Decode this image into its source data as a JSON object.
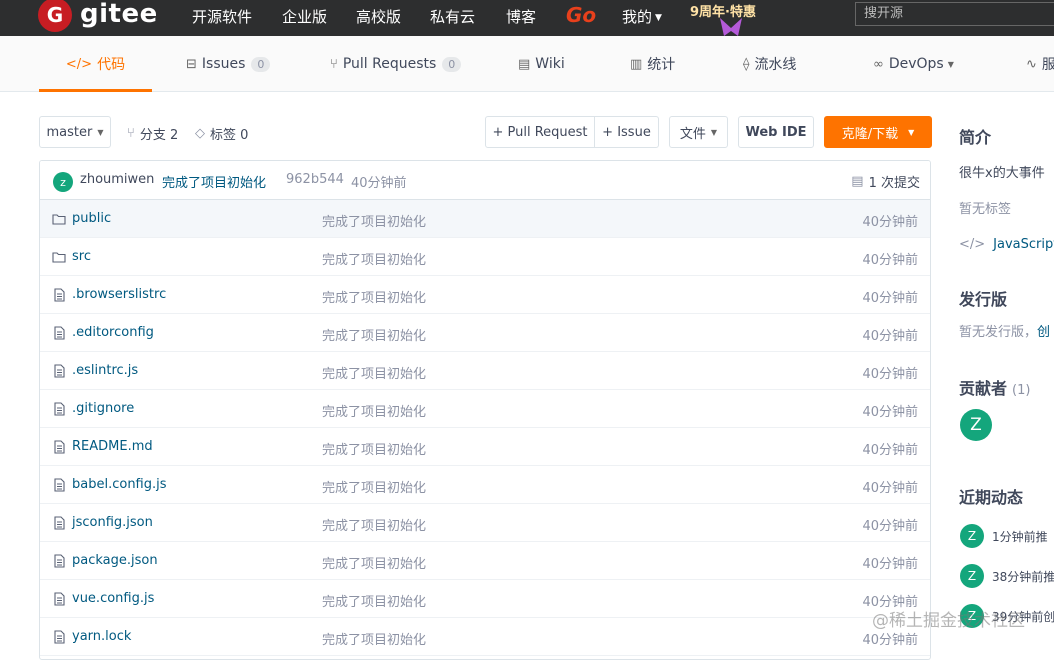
{
  "topnav": {
    "logo_letter": "G",
    "logo_text": "gitee",
    "items": [
      "开源软件",
      "企业版",
      "高校版",
      "私有云",
      "博客"
    ],
    "go_label": "Go",
    "mine_label": "我的",
    "promo": "9周年·特惠",
    "search_placeholder": "搜开源"
  },
  "tabs": [
    {
      "label": "代码",
      "icon": "code-icon",
      "glyph": "</>"
    },
    {
      "label": "Issues",
      "icon": "issue-icon",
      "glyph": "⊟",
      "count": "0"
    },
    {
      "label": "Pull Requests",
      "icon": "pull-request-icon",
      "glyph": "⑂",
      "count": "0"
    },
    {
      "label": "Wiki",
      "icon": "book-icon",
      "glyph": "▤"
    },
    {
      "label": "统计",
      "icon": "bar-chart-icon",
      "glyph": "▥"
    },
    {
      "label": "流水线",
      "icon": "pipeline-icon",
      "glyph": "⟠"
    },
    {
      "label": "DevOps",
      "icon": "infinity-icon",
      "glyph": "∞"
    },
    {
      "label": "服",
      "icon": "pulse-icon",
      "glyph": "∿"
    }
  ],
  "toolbar": {
    "branch": "master",
    "branches_label": "分支 2",
    "tags_label": "标签 0",
    "new_pr": "+ Pull Request",
    "new_issue": "+ Issue",
    "file_menu": "文件",
    "web_ide": "Web IDE",
    "clone": "克隆/下载"
  },
  "commit": {
    "avatar": "z",
    "user": "zhoumiwen",
    "message": "完成了项目初始化",
    "sha": "962b544",
    "time": "40分钟前",
    "count": "1 次提交"
  },
  "files": [
    {
      "name": "public",
      "type": "folder",
      "message": "完成了项目初始化",
      "time": "40分钟前"
    },
    {
      "name": "src",
      "type": "folder",
      "message": "完成了项目初始化",
      "time": "40分钟前"
    },
    {
      "name": ".browserslistrc",
      "type": "file",
      "message": "完成了项目初始化",
      "time": "40分钟前"
    },
    {
      "name": ".editorconfig",
      "type": "file",
      "message": "完成了项目初始化",
      "time": "40分钟前"
    },
    {
      "name": ".eslintrc.js",
      "type": "file",
      "message": "完成了项目初始化",
      "time": "40分钟前"
    },
    {
      "name": ".gitignore",
      "type": "file",
      "message": "完成了项目初始化",
      "time": "40分钟前"
    },
    {
      "name": "README.md",
      "type": "file",
      "message": "完成了项目初始化",
      "time": "40分钟前"
    },
    {
      "name": "babel.config.js",
      "type": "file",
      "message": "完成了项目初始化",
      "time": "40分钟前"
    },
    {
      "name": "jsconfig.json",
      "type": "file",
      "message": "完成了项目初始化",
      "time": "40分钟前"
    },
    {
      "name": "package.json",
      "type": "file",
      "message": "完成了项目初始化",
      "time": "40分钟前"
    },
    {
      "name": "vue.config.js",
      "type": "file",
      "message": "完成了项目初始化",
      "time": "40分钟前"
    },
    {
      "name": "yarn.lock",
      "type": "file",
      "message": "完成了项目初始化",
      "time": "40分钟前"
    }
  ],
  "sidebar": {
    "intro_title": "简介",
    "intro_desc": "很牛x的大事件",
    "no_tags": "暂无标签",
    "language": "JavaScript 等",
    "release_title": "发行版",
    "release_desc": "暂无发行版，",
    "release_link": "创",
    "contrib_title": "贡献者",
    "contrib_count": "(1)",
    "contrib_avatar": "Z",
    "activity_title": "近期动态",
    "activities": [
      {
        "avatar": "Z",
        "text": "1分钟前推"
      },
      {
        "avatar": "Z",
        "text": "38分钟前推"
      },
      {
        "avatar": "Z",
        "text": "39分钟前创"
      }
    ]
  },
  "watermark": "@稀土掘金技术社区",
  "colors": {
    "accent": "#fe7300",
    "brand": "#c71d23",
    "link": "#005980",
    "avatar": "#14a67c",
    "nav_bg": "#2d2e2f"
  }
}
